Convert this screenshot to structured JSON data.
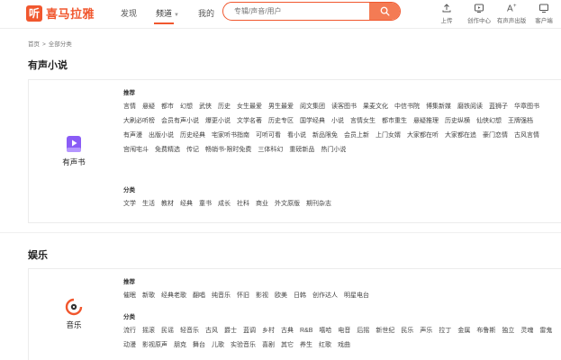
{
  "header": {
    "logo_mark": "听",
    "logo_text": "喜马拉雅",
    "nav": [
      {
        "label": "发现",
        "active": false
      },
      {
        "label": "频道",
        "active": true
      },
      {
        "label": "我的",
        "active": false
      }
    ],
    "nav_caret": "▼",
    "search_placeholder": "专辑/声音/用户",
    "tools": [
      {
        "label": "上传",
        "icon": "upload-icon"
      },
      {
        "label": "创作中心",
        "icon": "creation-icon"
      },
      {
        "label": "有声声出版",
        "icon": "publish-icon"
      },
      {
        "label": "客户端",
        "icon": "client-icon"
      }
    ]
  },
  "breadcrumb": {
    "home": "首页",
    "sep": ">",
    "current": "全部分类"
  },
  "sections": [
    {
      "title": "有声小说",
      "category": "有声书",
      "icon": "audiobook-icon",
      "icon_color": "#8a5cf6",
      "recommend_label": "推荐",
      "recommend_tags": [
        "言情",
        "悬疑",
        "都市",
        "幻想",
        "武侠",
        "历史",
        "女生最爱",
        "男生最爱",
        "阅文集团",
        "读客图书",
        "果麦文化",
        "中信书院",
        "博集新媒",
        "磨铁阅读",
        "蓝狮子",
        "华章图书",
        "大刷必听榜",
        "会员有声小说",
        "爆更小说",
        "文学名著",
        "历史专区",
        "国学经典",
        "小说",
        "言情女生",
        "都市重生",
        "悬疑推理",
        "历史纵横",
        "仙侠幻想",
        "王牌强档",
        "有声漫",
        "出版小说",
        "历史经典",
        "宅家听书指南",
        "可听可看",
        "看小说",
        "新品限免",
        "会员上新",
        "上门女婿",
        "大家都在听",
        "大家都在追",
        "豪门恋情",
        "古风言情",
        "宫闱宅斗",
        "免费精选",
        "传记",
        "畅销书-限时免费",
        "三体科幻",
        "重磅新品",
        "热门小说"
      ],
      "category_label": "分类",
      "category_tags": [
        "文学",
        "生活",
        "教材",
        "经典",
        "童书",
        "成长",
        "社科",
        "商业",
        "外文原版",
        "期刊杂志"
      ]
    },
    {
      "title": "娱乐",
      "category": "音乐",
      "icon": "music-icon",
      "icon_color": "#f1572e",
      "recommend_label": "推荐",
      "recommend_tags": [
        "催眠",
        "新歌",
        "经典老歌",
        "翻唱",
        "纯音乐",
        "怀旧",
        "影视",
        "欧美",
        "日韩",
        "创作达人",
        "明星电台"
      ],
      "category_label": "分类",
      "category_tags": [
        "流行",
        "摇滚",
        "民谣",
        "轻音乐",
        "古风",
        "爵士",
        "蓝调",
        "乡村",
        "古典",
        "R&B",
        "嘻哈",
        "电音",
        "后摇",
        "新世纪",
        "民乐",
        "声乐",
        "拉丁",
        "金属",
        "布鲁斯",
        "独立",
        "灵魂",
        "雷鬼",
        "动漫",
        "影视原声",
        "朋克",
        "舞台",
        "儿歌",
        "实验音乐",
        "喜剧",
        "其它",
        "养生",
        "红歌",
        "戏曲"
      ]
    }
  ]
}
